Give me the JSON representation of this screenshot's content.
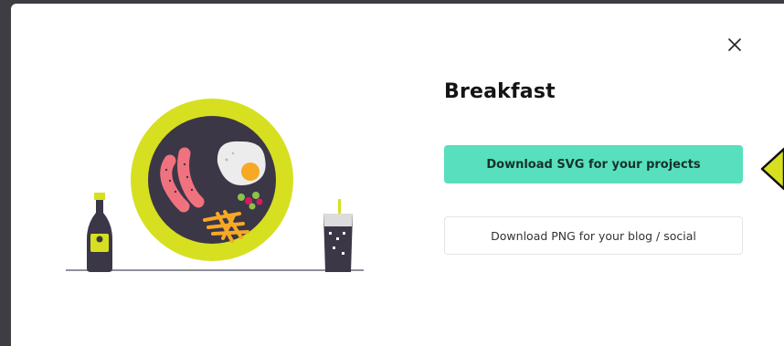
{
  "modal": {
    "title": "Breakfast",
    "download_svg_label": "Download SVG for your projects",
    "download_png_label": "Download PNG for your blog / social",
    "close_icon": "close-icon"
  },
  "colors": {
    "accent": "#58dfbe",
    "plate_rim": "#d6e020",
    "plate_center": "#3b3747",
    "backdrop": "#3d3d43"
  }
}
